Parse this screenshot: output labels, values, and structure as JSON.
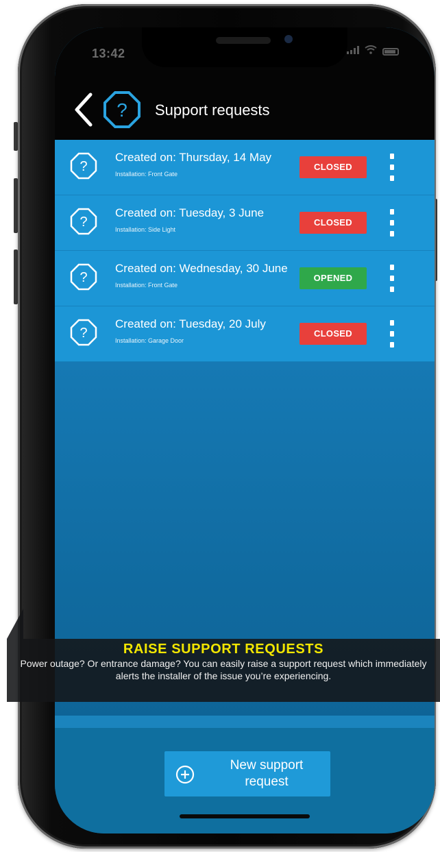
{
  "status_bar": {
    "time": "13:42"
  },
  "header": {
    "title": "Support requests"
  },
  "requests": [
    {
      "title": "Created on: Thursday, 14 May",
      "installation": "Installation: Front Gate",
      "status": "CLOSED"
    },
    {
      "title": "Created on: Tuesday, 3 June",
      "installation": "Installation: Side Light",
      "status": "CLOSED"
    },
    {
      "title": "Created on: Wednesday, 30 June",
      "installation": "Installation: Front Gate",
      "status": "OPENED"
    },
    {
      "title": "Created on: Tuesday, 20 July",
      "installation": "Installation: Garage Door",
      "status": "CLOSED"
    }
  ],
  "new_request_button": {
    "label": "New support request"
  },
  "caption": {
    "title": "RAISE SUPPORT REQUESTS",
    "body": "Power outage? Or entrance damage? You can easily raise a support request which immediately alerts the installer of the issue you’re experiencing."
  },
  "colors": {
    "list_row": "#1c96d6",
    "closed": "#e8403b",
    "opened": "#2fa84a",
    "caption_title": "#f2e600"
  },
  "icons": {
    "back": "chevron-left-icon",
    "help": "question-octagon-icon",
    "more": "kebab-menu-icon",
    "add": "plus-circle-icon"
  }
}
